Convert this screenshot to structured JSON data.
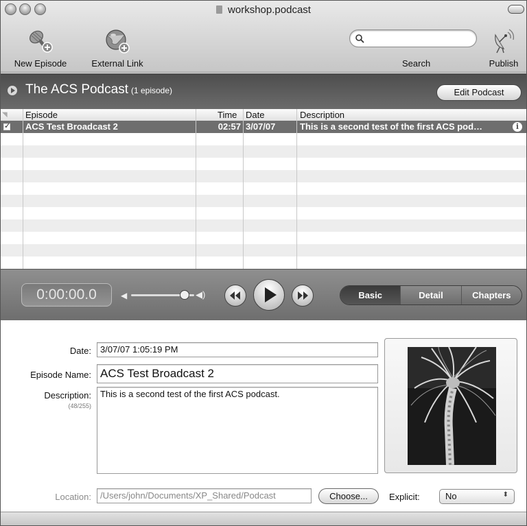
{
  "window": {
    "title": "workshop.podcast"
  },
  "toolbar": {
    "new_episode": "New Episode",
    "external_link": "External Link",
    "search_label": "Search",
    "search_placeholder": "",
    "publish": "Publish"
  },
  "podcast": {
    "title": "The ACS Podcast",
    "count": "(1 episode)",
    "edit_button": "Edit Podcast"
  },
  "table": {
    "columns": {
      "episode": "Episode",
      "time": "Time",
      "date": "Date",
      "description": "Description"
    },
    "rows": [
      {
        "episode": "ACS Test Broadcast 2",
        "time": "02:57",
        "date": "3/07/07",
        "description": "This is a second  test of the first ACS pod…",
        "checked": true
      }
    ]
  },
  "player": {
    "time": "0:00:00.0",
    "volume": 0.85,
    "tabs": [
      "Basic",
      "Detail",
      "Chapters"
    ],
    "active_tab": "Basic"
  },
  "detail": {
    "date_label": "Date:",
    "date_value": "3/07/07 1:05:19 PM",
    "name_label": "Episode Name:",
    "name_value": "ACS Test Broadcast 2",
    "description_label": "Description:",
    "description_count": "(48/255)",
    "description_value": "This is a second  test of the first ACS podcast.",
    "location_label": "Location:",
    "location_value": "/Users/john/Documents/XP_Shared/Podcast",
    "choose_button": "Choose...",
    "explicit_label": "Explicit:",
    "explicit_value": "No"
  },
  "colors": {
    "selected_row": "#6e6e6e",
    "podcast_bar": "#5a5a5a",
    "player_bar": "#7f7f7f"
  }
}
